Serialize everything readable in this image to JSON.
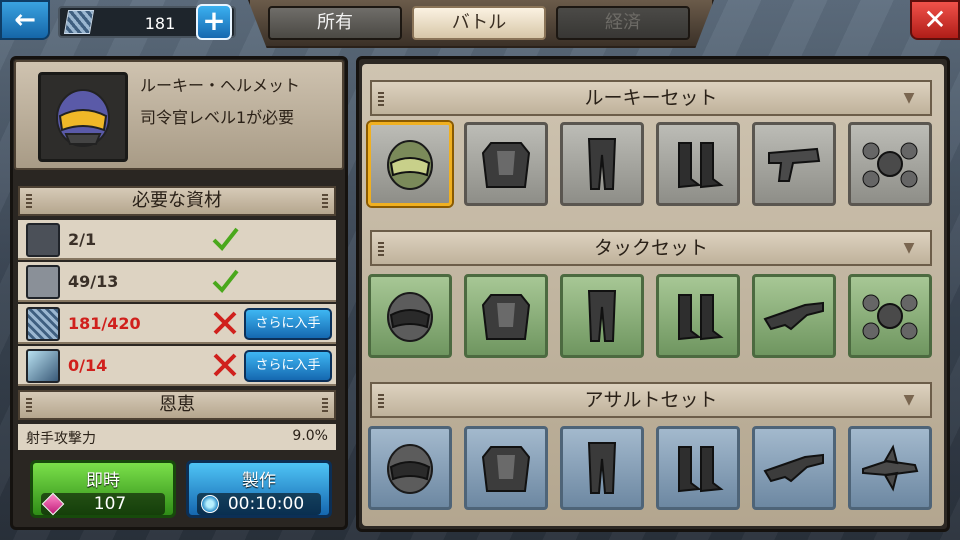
{
  "topbar": {
    "resource_value": "181",
    "plus_label": "+",
    "back_label": "←",
    "close_label": "✕",
    "tabs": [
      {
        "label": "所有",
        "state": "inactive"
      },
      {
        "label": "バトル",
        "state": "active"
      },
      {
        "label": "経済",
        "state": "disabled"
      }
    ]
  },
  "item": {
    "name": "ルーキー・ヘルメット",
    "requirement": "司令官レベル1が必要"
  },
  "materials": {
    "title": "必要な資材",
    "rows": [
      {
        "count": "2/1",
        "status": "ok",
        "icon": "helmet-material-icon"
      },
      {
        "count": "49/13",
        "status": "ok",
        "icon": "armor-plate-icon"
      },
      {
        "count": "181/420",
        "status": "insufficient",
        "icon": "mesh-plate-icon",
        "button": "さらに入手"
      },
      {
        "count": "0/14",
        "status": "insufficient",
        "icon": "capsule-icon",
        "button": "さらに入手"
      }
    ]
  },
  "benefits": {
    "title": "恩恵",
    "rows": [
      {
        "label": "射手攻撃力",
        "value": "9.0%"
      }
    ]
  },
  "actions": {
    "instant_label": "即時",
    "instant_cost": "107",
    "craft_label": "製作",
    "craft_time": "00:10:00"
  },
  "sets": [
    {
      "title": "ルーキーセット",
      "theme": "grey",
      "chevron": "chevron-down-icon",
      "items": [
        "helmet",
        "body-armor",
        "pants",
        "boots",
        "pistol",
        "drone"
      ]
    },
    {
      "title": "タックセット",
      "theme": "green",
      "chevron": "chevron-down-icon",
      "items": [
        "helmet",
        "body-armor",
        "pants",
        "boots",
        "rifle",
        "drone"
      ]
    },
    {
      "title": "アサルトセット",
      "theme": "blue",
      "chevron": "chevron-down-icon",
      "items": [
        "helmet",
        "body-armor",
        "pants",
        "boots",
        "rifle",
        "jet"
      ]
    }
  ],
  "colors": {
    "active_tab": "#f5ead6",
    "insufficient": "#d0201c",
    "ok_check": "#4aa81c",
    "selected_border": "#f0b020"
  }
}
